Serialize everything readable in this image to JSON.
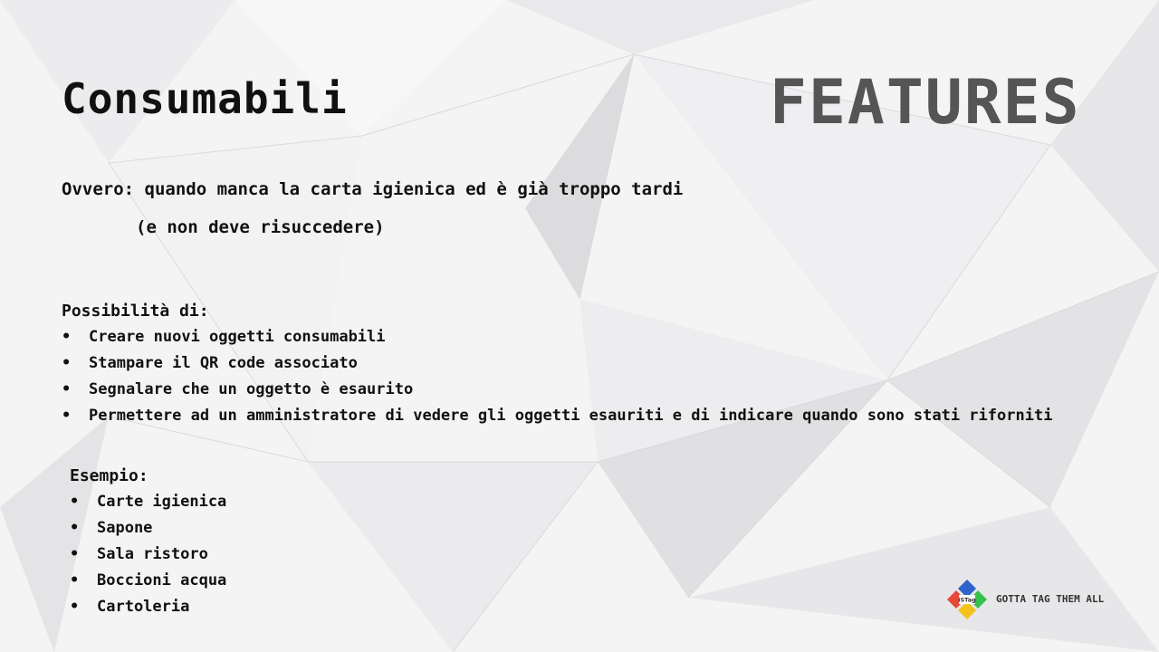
{
  "slide": {
    "title": "Consumabili",
    "section_label": "FEATURES",
    "intro": "Ovvero: quando manca la carta igienica ed è già troppo tardi",
    "intro_note": "(e non deve risuccedere)",
    "possibilities_label": "Possibilità di:",
    "possibilities": [
      "Creare nuovi oggetti consumabili",
      "Stampare il QR code associato",
      "Segnalare che un oggetto è esaurito",
      "Permettere ad un amministratore di vedere gli oggetti esauriti e di indicare quando sono stati riforniti"
    ],
    "examples_label": "Esempio:",
    "examples": [
      "Carte igienica",
      "Sapone",
      "Sala ristoro",
      "Boccioni acqua",
      "Cartoleria"
    ],
    "bullet": "•"
  },
  "footer": {
    "logo_text": "iSTag",
    "tagline": "GOTTA TAG THEM ALL"
  },
  "colors": {
    "background": "#f4f4f5",
    "text": "#111111",
    "features": "#555555",
    "logo_red": "#e8483a",
    "logo_blue": "#2f63c9",
    "logo_green": "#35c24a",
    "logo_yellow": "#f4c21c"
  }
}
